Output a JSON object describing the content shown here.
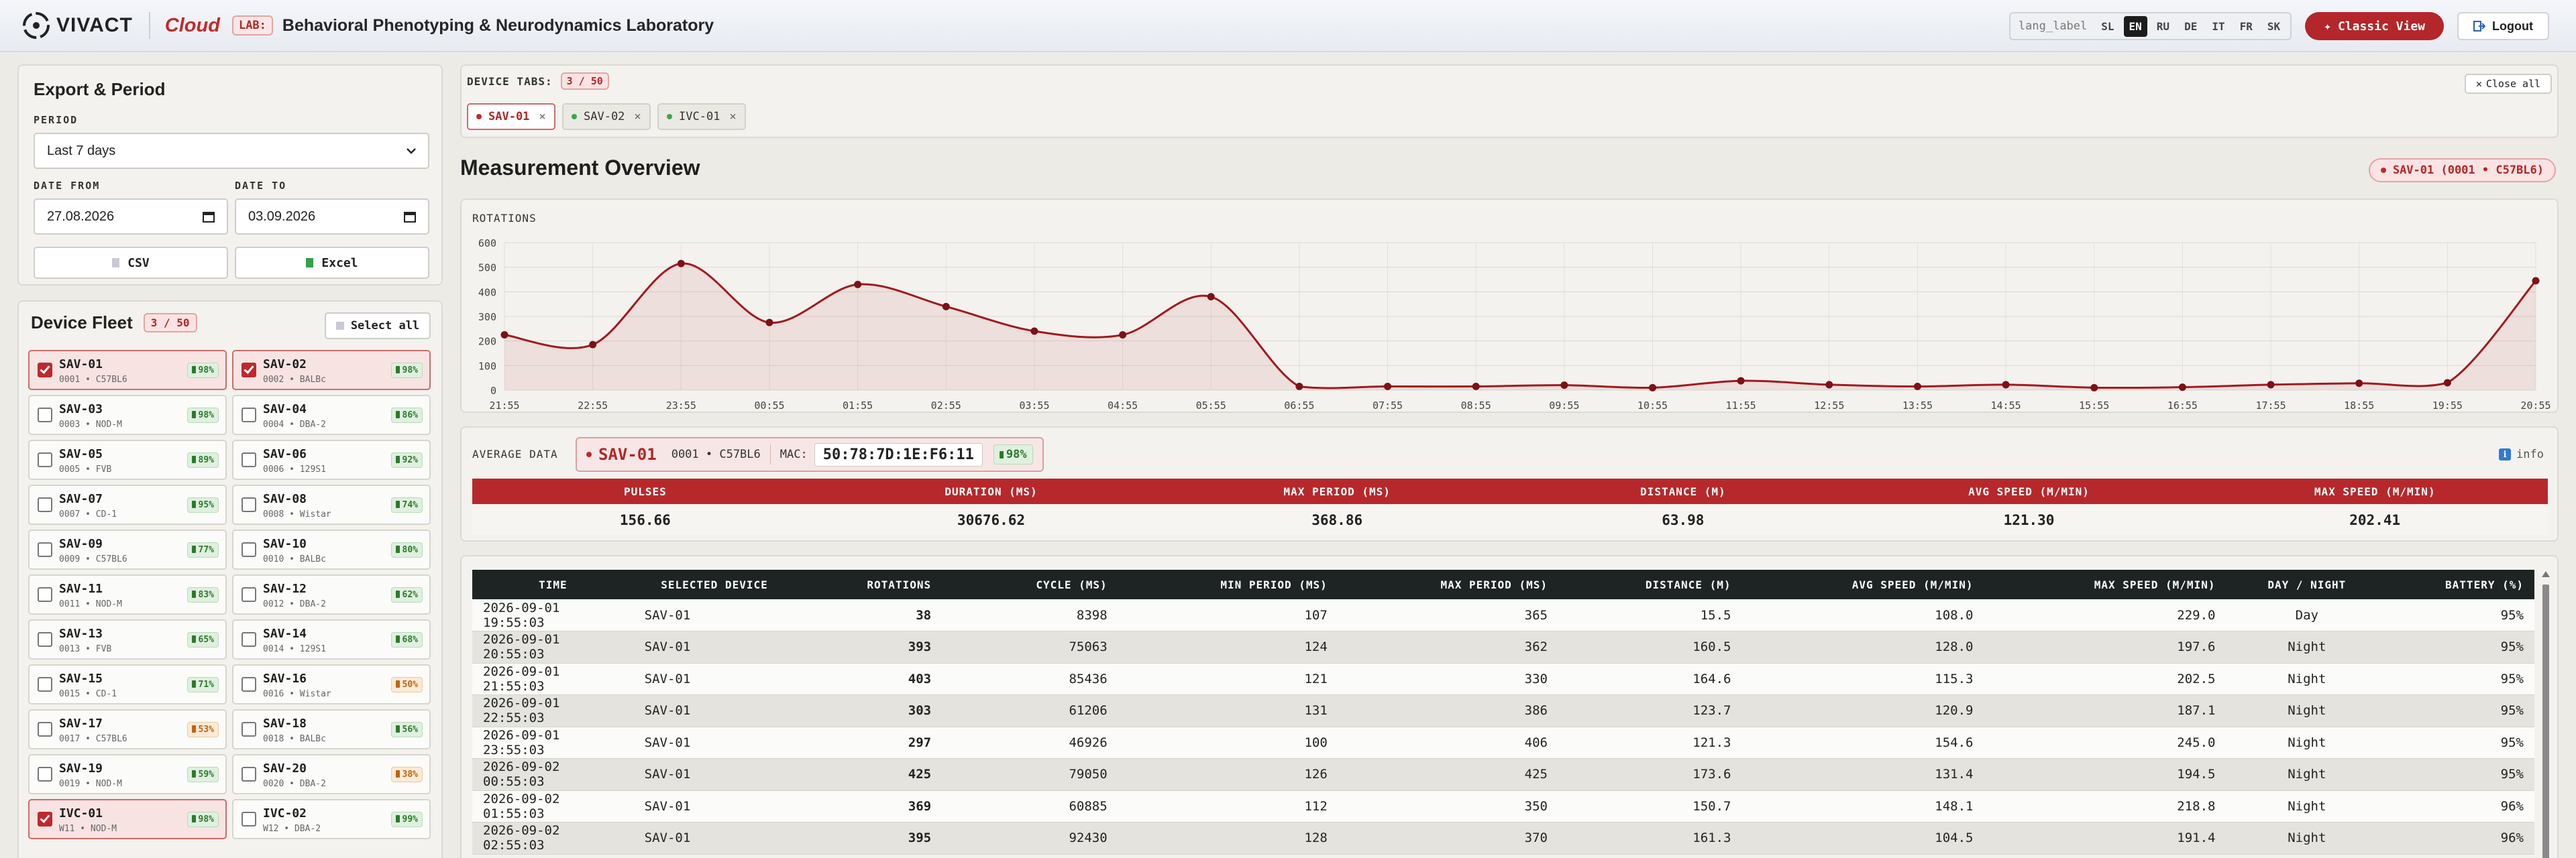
{
  "header": {
    "brand": "VIVACT",
    "cloud": "Cloud",
    "lab_badge": "LAB:",
    "lab_title": "Behavioral Phenotyping & Neurodynamics Laboratory",
    "lang_label": "lang_label",
    "languages": [
      "SL",
      "EN",
      "RU",
      "DE",
      "IT",
      "FR",
      "SK"
    ],
    "active_language": "EN",
    "classic_view": "Classic View",
    "logout": "Logout"
  },
  "export": {
    "title": "Export & Period",
    "period_label": "PERIOD",
    "period_value": "Last 7 days",
    "date_from_label": "DATE FROM",
    "date_from": "27.08.2026",
    "date_to_label": "DATE TO",
    "date_to": "03.09.2026",
    "csv": "CSV",
    "excel": "Excel"
  },
  "fleet": {
    "title": "Device Fleet",
    "count": "3 / 50",
    "select_all": "Select all",
    "devices": [
      {
        "name": "SAV-01",
        "sub": "0001 • C57BL6",
        "battery": "98%",
        "selected": true,
        "warn": false
      },
      {
        "name": "SAV-02",
        "sub": "0002 • BALBc",
        "battery": "98%",
        "selected": true,
        "warn": false
      },
      {
        "name": "SAV-03",
        "sub": "0003 • NOD-M",
        "battery": "98%",
        "selected": false,
        "warn": false
      },
      {
        "name": "SAV-04",
        "sub": "0004 • DBA-2",
        "battery": "86%",
        "selected": false,
        "warn": false
      },
      {
        "name": "SAV-05",
        "sub": "0005 • FVB",
        "battery": "89%",
        "selected": false,
        "warn": false
      },
      {
        "name": "SAV-06",
        "sub": "0006 • 129S1",
        "battery": "92%",
        "selected": false,
        "warn": false
      },
      {
        "name": "SAV-07",
        "sub": "0007 • CD-1",
        "battery": "95%",
        "selected": false,
        "warn": false
      },
      {
        "name": "SAV-08",
        "sub": "0008 • Wistar",
        "battery": "74%",
        "selected": false,
        "warn": false
      },
      {
        "name": "SAV-09",
        "sub": "0009 • C57BL6",
        "battery": "77%",
        "selected": false,
        "warn": false
      },
      {
        "name": "SAV-10",
        "sub": "0010 • BALBc",
        "battery": "80%",
        "selected": false,
        "warn": false
      },
      {
        "name": "SAV-11",
        "sub": "0011 • NOD-M",
        "battery": "83%",
        "selected": false,
        "warn": false
      },
      {
        "name": "SAV-12",
        "sub": "0012 • DBA-2",
        "battery": "62%",
        "selected": false,
        "warn": false
      },
      {
        "name": "SAV-13",
        "sub": "0013 • FVB",
        "battery": "65%",
        "selected": false,
        "warn": false
      },
      {
        "name": "SAV-14",
        "sub": "0014 • 129S1",
        "battery": "68%",
        "selected": false,
        "warn": false
      },
      {
        "name": "SAV-15",
        "sub": "0015 • CD-1",
        "battery": "71%",
        "selected": false,
        "warn": false
      },
      {
        "name": "SAV-16",
        "sub": "0016 • Wistar",
        "battery": "50%",
        "selected": false,
        "warn": true
      },
      {
        "name": "SAV-17",
        "sub": "0017 • C57BL6",
        "battery": "53%",
        "selected": false,
        "warn": true
      },
      {
        "name": "SAV-18",
        "sub": "0018 • BALBc",
        "battery": "56%",
        "selected": false,
        "warn": false
      },
      {
        "name": "SAV-19",
        "sub": "0019 • NOD-M",
        "battery": "59%",
        "selected": false,
        "warn": false
      },
      {
        "name": "SAV-20",
        "sub": "0020 • DBA-2",
        "battery": "38%",
        "selected": false,
        "warn": true
      },
      {
        "name": "IVC-01",
        "sub": "W11 • NOD-M",
        "battery": "98%",
        "selected": true,
        "warn": false
      },
      {
        "name": "IVC-02",
        "sub": "W12 • DBA-2",
        "battery": "99%",
        "selected": false,
        "warn": false
      }
    ]
  },
  "tabs": {
    "label": "DEVICE TABS:",
    "count": "3 / 50",
    "close_all": "Close all",
    "items": [
      {
        "name": "SAV-01",
        "active": true
      },
      {
        "name": "SAV-02",
        "active": false
      },
      {
        "name": "IVC-01",
        "active": false
      }
    ]
  },
  "overview": {
    "title": "Measurement Overview",
    "selected_pill": "SAV-01 (0001 • C57BL6)"
  },
  "chart_data": {
    "type": "line",
    "title": "ROTATIONS",
    "categories": [
      "21:55",
      "22:55",
      "23:55",
      "00:55",
      "01:55",
      "02:55",
      "03:55",
      "04:55",
      "05:55",
      "06:55",
      "07:55",
      "08:55",
      "09:55",
      "10:55",
      "11:55",
      "12:55",
      "13:55",
      "14:55",
      "15:55",
      "16:55",
      "17:55",
      "18:55",
      "19:55",
      "20:55"
    ],
    "values": [
      225,
      185,
      515,
      275,
      430,
      340,
      240,
      225,
      380,
      15,
      15,
      15,
      20,
      10,
      38,
      22,
      15,
      22,
      10,
      12,
      22,
      28,
      30,
      445
    ],
    "ylim": [
      0,
      600
    ],
    "yticks": [
      0,
      100,
      200,
      300,
      400,
      500,
      600
    ],
    "color": "#a3191f",
    "grid": true
  },
  "average": {
    "label": "AVERAGE DATA",
    "device": "SAV-01",
    "device_sub": "0001 • C57BL6",
    "mac_label": "MAC:",
    "mac": "50:78:7D:1E:F6:11",
    "battery": "98%",
    "info": "info",
    "headers": [
      "PULSES",
      "DURATION (MS)",
      "MAX PERIOD (MS)",
      "DISTANCE (M)",
      "AVG SPEED (M/MIN)",
      "MAX SPEED (M/MIN)"
    ],
    "values": [
      "156.66",
      "30676.62",
      "368.86",
      "63.98",
      "121.30",
      "202.41"
    ]
  },
  "table": {
    "headers": [
      "TIME",
      "SELECTED DEVICE",
      "ROTATIONS",
      "CYCLE (MS)",
      "MIN PERIOD (MS)",
      "MAX PERIOD (MS)",
      "DISTANCE (M)",
      "AVG SPEED (M/MIN)",
      "MAX SPEED (M/MIN)",
      "DAY / NIGHT",
      "BATTERY (%)"
    ],
    "rows": [
      [
        "2026-09-01 19:55:03",
        "SAV-01",
        "38",
        "8398",
        "107",
        "365",
        "15.5",
        "108.0",
        "229.0",
        "Day",
        "95%"
      ],
      [
        "2026-09-01 20:55:03",
        "SAV-01",
        "393",
        "75063",
        "124",
        "362",
        "160.5",
        "128.0",
        "197.6",
        "Night",
        "95%"
      ],
      [
        "2026-09-01 21:55:03",
        "SAV-01",
        "403",
        "85436",
        "121",
        "330",
        "164.6",
        "115.3",
        "202.5",
        "Night",
        "95%"
      ],
      [
        "2026-09-01 22:55:03",
        "SAV-01",
        "303",
        "61206",
        "131",
        "386",
        "123.7",
        "120.9",
        "187.1",
        "Night",
        "95%"
      ],
      [
        "2026-09-01 23:55:03",
        "SAV-01",
        "297",
        "46926",
        "100",
        "406",
        "121.3",
        "154.6",
        "245.0",
        "Night",
        "95%"
      ],
      [
        "2026-09-02 00:55:03",
        "SAV-01",
        "425",
        "79050",
        "126",
        "425",
        "173.6",
        "131.4",
        "194.5",
        "Night",
        "95%"
      ],
      [
        "2026-09-02 01:55:03",
        "SAV-01",
        "369",
        "60885",
        "112",
        "350",
        "150.7",
        "148.1",
        "218.8",
        "Night",
        "96%"
      ],
      [
        "2026-09-02 02:55:03",
        "SAV-01",
        "395",
        "92430",
        "128",
        "370",
        "161.3",
        "104.5",
        "191.4",
        "Night",
        "96%"
      ]
    ]
  }
}
